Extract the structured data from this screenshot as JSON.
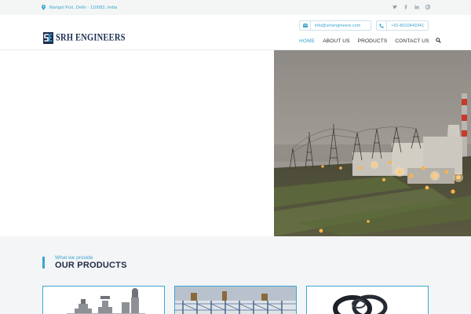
{
  "topbar": {
    "location": "Mangol Puri, Delhi - 110083, India",
    "location_icon": "map-pin-icon",
    "social": [
      {
        "name": "twitter-icon",
        "glyph": "✓"
      },
      {
        "name": "facebook-icon",
        "glyph": "f"
      },
      {
        "name": "linkedin-icon",
        "glyph": "in"
      },
      {
        "name": "pinterest-icon",
        "glyph": "℗"
      }
    ]
  },
  "header": {
    "brand": "SRH ENGINEERS",
    "email": "info@srhengineers.com",
    "phone": "+91-8010449341",
    "nav": {
      "home": "HOME",
      "about": "ABOUT US",
      "products": "PRODUCTS",
      "contact": "CONTACT US"
    }
  },
  "products_section": {
    "subtitle": "What we provide",
    "title": "OUR PRODUCTS"
  },
  "colors": {
    "accent": "#3aa6cf",
    "brand": "#1a2e52",
    "heading": "#1f2a44",
    "section_bg": "#f3f5f6"
  }
}
